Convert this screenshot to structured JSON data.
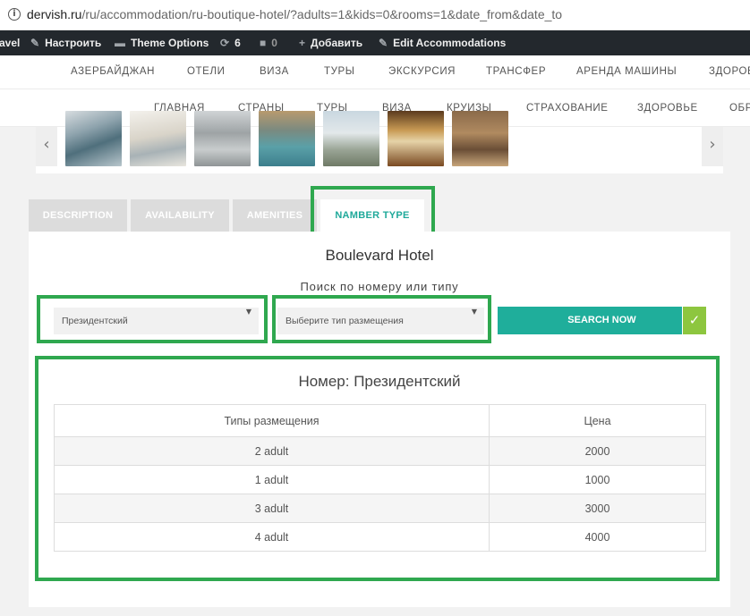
{
  "browser": {
    "url_host": "dervish.ru",
    "url_path": "/ru/accommodation/ru-boutique-hotel/?adults=1&kids=0&rooms=1&date_from&date_to"
  },
  "admin_bar": {
    "items": [
      "avel",
      "Настроить",
      "Theme Options",
      "6",
      "0",
      "Добавить",
      "Edit Accommodations"
    ]
  },
  "main_menu": [
    "АЗЕРБАЙДЖАН",
    "ОТЕЛИ",
    "ВИЗА",
    "ТУРЫ",
    "ЭКСКУРСИЯ",
    "ТРАНСФЕР",
    "АРЕНДА МАШИНЫ",
    "ЗДОРОВ"
  ],
  "sub_menu": [
    "ГЛАВНАЯ",
    "СТРАНЫ",
    "ТУРЫ",
    "ВИЗА",
    "КРУИЗЫ",
    "СТРАХОВАНИЕ",
    "ЗДОРОВЬЕ",
    "ОБР"
  ],
  "gallery": {
    "prev": "‹",
    "next": "›"
  },
  "tabs": [
    "DESCRIPTION",
    "AVAILABILITY",
    "AMENITIES",
    "NAMBER TYPE"
  ],
  "panel": {
    "hotel_name": "Boulevard Hotel",
    "search_title": "Поиск по номеру или типу",
    "room_select_value": "Президентский",
    "type_select_value": "Выберите тип размещения",
    "search_button": "SEARCH NOW",
    "check": "✓",
    "room_title": "Номер: Президентский",
    "table": {
      "headers": [
        "Типы размещения",
        "Цена"
      ],
      "rows": [
        [
          "2 adult",
          "2000"
        ],
        [
          "1 adult",
          "1000"
        ],
        [
          "3 adult",
          "3000"
        ],
        [
          "4 adult",
          "4000"
        ]
      ]
    }
  },
  "colors": {
    "accent": "#1fae9b",
    "check": "#8dc63f",
    "highlight_box": "#2fa84f"
  }
}
